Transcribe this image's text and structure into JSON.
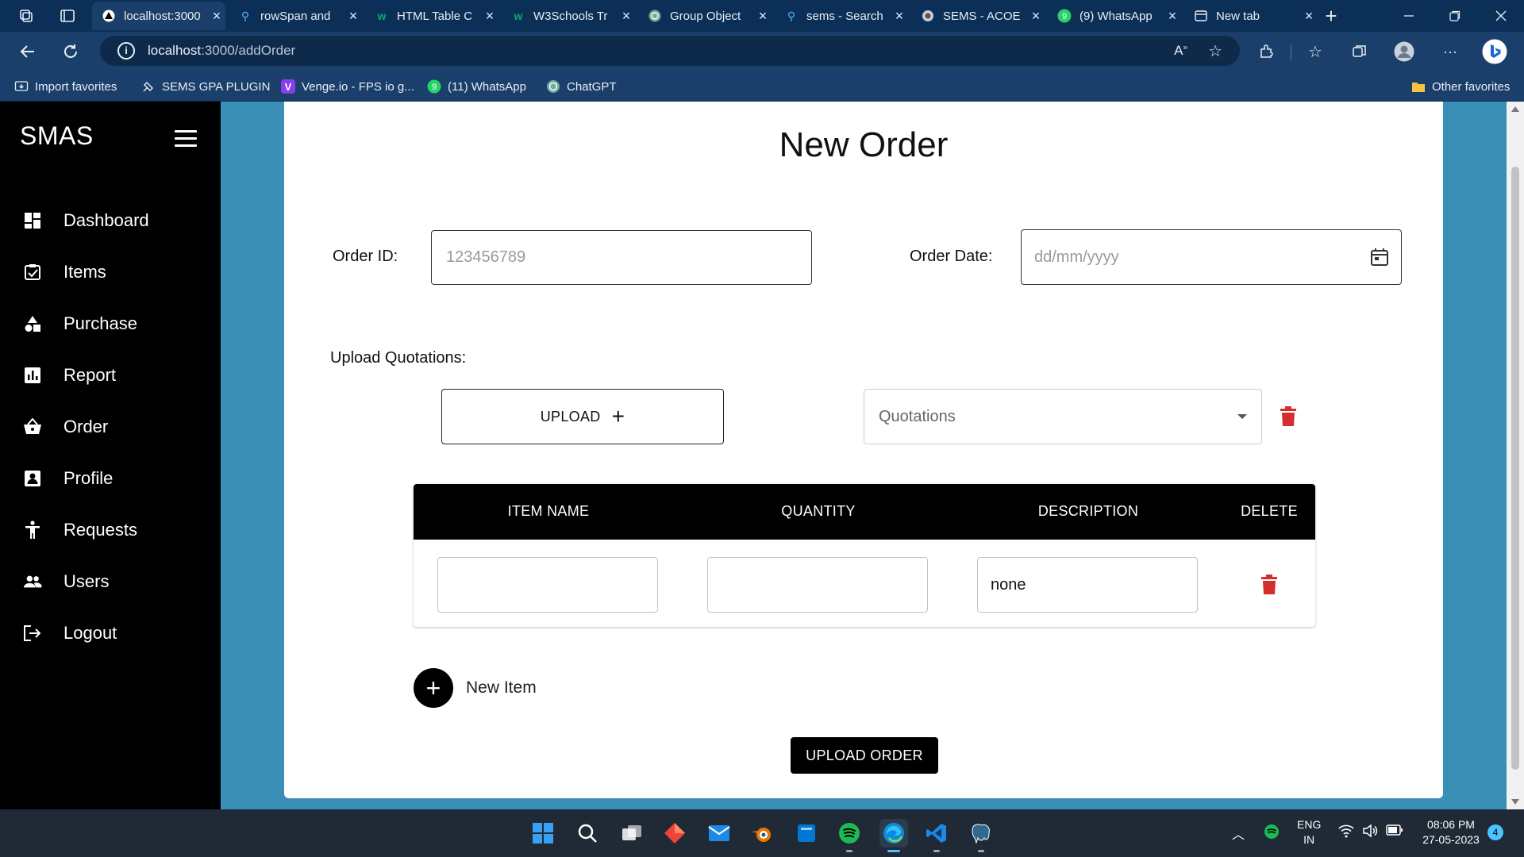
{
  "browser": {
    "tabs": [
      {
        "title": "localhost:3000",
        "active": true
      },
      {
        "title": "rowSpan and",
        "active": false
      },
      {
        "title": "HTML Table C",
        "active": false
      },
      {
        "title": "W3Schools Tr",
        "active": false
      },
      {
        "title": "Group Object",
        "active": false
      },
      {
        "title": "sems - Search",
        "active": false
      },
      {
        "title": "SEMS - ACOE",
        "active": false
      },
      {
        "title": "(9) WhatsApp",
        "active": false
      },
      {
        "title": "New tab",
        "active": false
      }
    ],
    "url_host": "localhost",
    "url_path": ":3000/addOrder",
    "favorites": [
      {
        "label": "Import favorites"
      },
      {
        "label": "SEMS GPA PLUGIN"
      },
      {
        "label": "Venge.io - FPS io g..."
      },
      {
        "label": "(11) WhatsApp"
      },
      {
        "label": "ChatGPT"
      }
    ],
    "other_favorites": "Other favorites",
    "whatsapp_badge_tab": "9",
    "whatsapp_badge_fav": "9"
  },
  "sidebar": {
    "brand": "SMAS",
    "items": [
      {
        "label": "Dashboard",
        "icon": "dashboard-icon"
      },
      {
        "label": "Items",
        "icon": "items-icon"
      },
      {
        "label": "Purchase",
        "icon": "purchase-icon"
      },
      {
        "label": "Report",
        "icon": "report-icon"
      },
      {
        "label": "Order",
        "icon": "basket-icon"
      },
      {
        "label": "Profile",
        "icon": "profile-icon"
      },
      {
        "label": "Requests",
        "icon": "requests-icon"
      },
      {
        "label": "Users",
        "icon": "users-icon"
      },
      {
        "label": "Logout",
        "icon": "logout-icon"
      }
    ]
  },
  "form": {
    "title": "New Order",
    "order_id_label": "Order ID:",
    "order_id_placeholder": "123456789",
    "order_date_label": "Order Date:",
    "order_date_placeholder": "dd/mm/yyyy",
    "upload_label": "Upload Quotations:",
    "upload_button": "UPLOAD",
    "quotations_select": "Quotations",
    "table": {
      "headers": [
        "ITEM NAME",
        "QUANTITY",
        "DESCRIPTION",
        "DELETE"
      ],
      "rows": [
        {
          "item_name": "",
          "quantity": "",
          "description": "none"
        }
      ]
    },
    "new_item": "New Item",
    "submit": "UPLOAD ORDER"
  },
  "taskbar": {
    "language": "ENG",
    "region": "IN",
    "time": "08:06 PM",
    "date": "27-05-2023",
    "notifications": "4"
  },
  "colors": {
    "sidebar": "#000000",
    "content_bg": "#3a8fb7",
    "delete_red": "#d32f2f",
    "browser_dark": "#0c2f57"
  }
}
